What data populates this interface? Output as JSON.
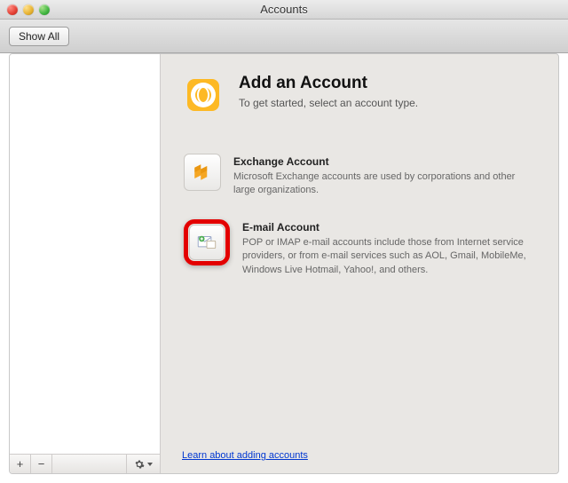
{
  "window": {
    "title": "Accounts"
  },
  "toolbar": {
    "show_all_label": "Show All"
  },
  "sidebar_footer": {
    "add_label": "+",
    "remove_label": "−"
  },
  "hero": {
    "title": "Add an Account",
    "subtitle": "To get started, select an account type."
  },
  "options": {
    "exchange": {
      "title": "Exchange Account",
      "desc": "Microsoft Exchange accounts are used by corporations and other large organizations."
    },
    "email": {
      "title": "E-mail Account",
      "desc": "POP or IMAP e-mail accounts include those from Internet service providers, or from e-mail services such as AOL, Gmail, MobileMe, Windows Live Hotmail, Yahoo!, and others."
    }
  },
  "learn_link": "Learn about adding accounts"
}
